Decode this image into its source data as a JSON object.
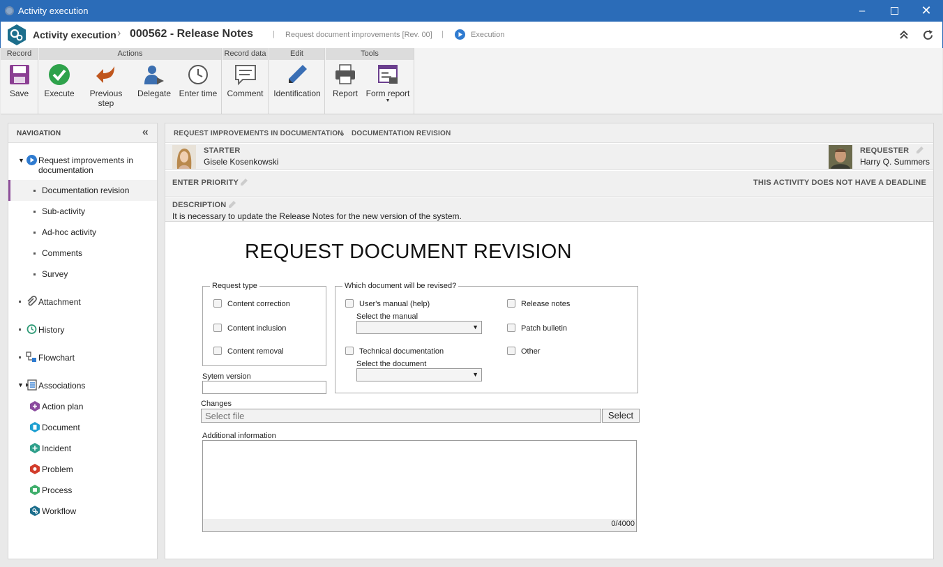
{
  "window": {
    "title": "Activity execution"
  },
  "header": {
    "app": "Activity execution",
    "record": "000562 - Release Notes",
    "subtitle": "Request document improvements [Rev. 00]",
    "status": "Execution"
  },
  "ribbon": {
    "groups": [
      "Record",
      "Actions",
      "Record data",
      "Edit",
      "Tools"
    ],
    "buttons": {
      "save": "Save",
      "execute": "Execute",
      "previous": "Previous step",
      "delegate": "Delegate",
      "enter_time": "Enter time",
      "comment": "Comment",
      "identification": "Identification",
      "report": "Report",
      "form_report": "Form report"
    }
  },
  "nav": {
    "title": "NAVIGATION",
    "process": "Request improvements in documentation",
    "subitems": [
      "Documentation revision",
      "Sub-activity",
      "Ad-hoc activity",
      "Comments",
      "Survey"
    ],
    "items": [
      "Attachment",
      "History",
      "Flowchart",
      "Associations"
    ],
    "associations": [
      "Action plan",
      "Document",
      "Incident",
      "Problem",
      "Process",
      "Workflow"
    ]
  },
  "main": {
    "breadcrumb": [
      "REQUEST IMPROVEMENTS IN DOCUMENTATION",
      "DOCUMENTATION REVISION"
    ],
    "starter_label": "STARTER",
    "starter_name": "Gisele Kosenkowski",
    "requester_label": "REQUESTER",
    "requester_name": "Harry Q. Summers",
    "priority_label": "ENTER PRIORITY",
    "deadline": "THIS ACTIVITY DOES NOT HAVE A DEADLINE",
    "description_label": "DESCRIPTION",
    "description": "It is necessary to update the Release Notes for the new version of the system."
  },
  "form": {
    "title": "REQUEST DOCUMENT REVISION",
    "request_type_legend": "Request type",
    "request_types": [
      "Content correction",
      "Content inclusion",
      "Content removal"
    ],
    "which_doc_legend": "Which document will be revised?",
    "manual_option": "User's manual (help)",
    "select_manual": "Select the manual",
    "techdoc_option": "Technical documentation",
    "select_document": "Select the document",
    "release_notes": "Release notes",
    "patch_bulletin": "Patch bulletin",
    "other": "Other",
    "system_version": "Sytem version",
    "changes": "Changes",
    "file_placeholder": "Select file",
    "select_btn": "Select",
    "additional": "Additional information",
    "counter": "0/4000"
  }
}
